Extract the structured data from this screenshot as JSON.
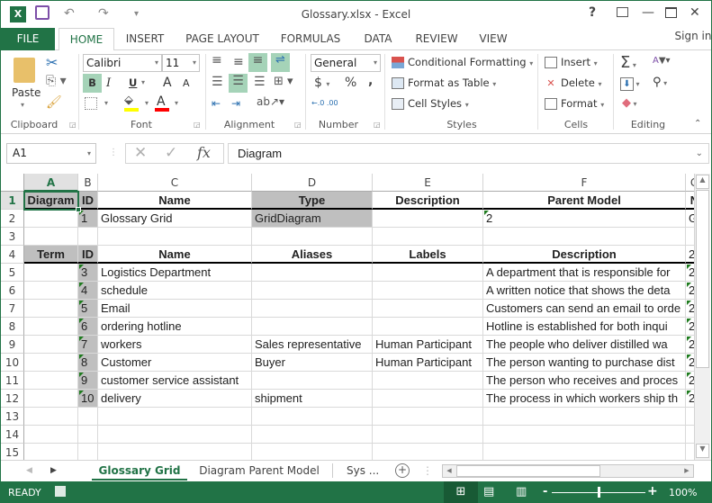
{
  "window": {
    "title": "Glossary.xlsx - Excel",
    "help": "?",
    "restore_ribbon": "⊼",
    "minimize": "—",
    "maximize": "☐",
    "close": "✕"
  },
  "quick_access": {
    "app_icon": "X",
    "save": "💾",
    "undo": "↶",
    "redo": "↷",
    "customize": "⩡"
  },
  "tabs": [
    "FILE",
    "HOME",
    "INSERT",
    "PAGE LAYOUT",
    "FORMULAS",
    "DATA",
    "REVIEW",
    "VIEW"
  ],
  "sign_in": "Sign in",
  "ribbon": {
    "clipboard": {
      "label": "Clipboard",
      "paste": "Paste"
    },
    "font": {
      "label": "Font",
      "name": "Calibri",
      "size": "11",
      "bold": "B",
      "italic": "I",
      "underline": "U",
      "grow": "A",
      "shrink": "A",
      "font_color": "A",
      "fill_color": "#ffff00",
      "text_color": "#ff0000"
    },
    "alignment": {
      "label": "Alignment"
    },
    "number": {
      "label": "Number",
      "format": "General",
      "currency": "$",
      "percent": "%",
      "comma": ",",
      "inc_dec": "←.0 .00",
      "dec_dec": ".00 →.0"
    },
    "styles": {
      "label": "Styles",
      "conditional": "Conditional Formatting",
      "format_table": "Format as Table",
      "cell_styles": "Cell Styles"
    },
    "cells": {
      "label": "Cells",
      "insert": "Insert",
      "delete": "Delete",
      "format": "Format"
    },
    "editing": {
      "label": "Editing",
      "sum": "Σ",
      "sort": "A↓Z",
      "find": "🔍",
      "fill": "⬇",
      "clear": "◆"
    }
  },
  "formula_bar": {
    "name_box": "A1",
    "cancel": "✕",
    "enter": "✓",
    "fx": "fx",
    "value": "Diagram"
  },
  "columns": [
    "A",
    "B",
    "C",
    "D",
    "E",
    "F",
    "G"
  ],
  "rows": [
    "1",
    "2",
    "3",
    "4",
    "5",
    "6",
    "7",
    "8",
    "9",
    "10",
    "11",
    "12",
    "13",
    "14",
    "15"
  ],
  "cells": {
    "r1": [
      "Diagram",
      "ID",
      "Name",
      "Type",
      "Description",
      "Parent Model",
      "N"
    ],
    "r2": [
      "",
      "1",
      "Glossary Grid",
      "GridDiagram",
      "",
      "2",
      "G"
    ],
    "r4": [
      "Term",
      "ID",
      "Name",
      "Aliases",
      "Labels",
      "Description",
      "2"
    ],
    "data": [
      [
        "",
        "3",
        "Logistics Department",
        "",
        "",
        "A department that is responsible for",
        "2"
      ],
      [
        "",
        "4",
        "schedule",
        "",
        "",
        "A written notice that shows the deta",
        "2"
      ],
      [
        "",
        "5",
        "Email",
        "",
        "",
        "Customers can send an email to orde",
        "2"
      ],
      [
        "",
        "6",
        "ordering hotline",
        "",
        "",
        "Hotline is established for both inqui",
        "2"
      ],
      [
        "",
        "7",
        "workers",
        "Sales representative",
        "Human Participant",
        "The people who deliver distilled wa",
        "2"
      ],
      [
        "",
        "8",
        "Customer",
        "Buyer",
        "Human Participant",
        "The person wanting to purchase dist",
        "2"
      ],
      [
        "",
        "9",
        "customer service assistant",
        "",
        "",
        "The person who receives and proces",
        "2"
      ],
      [
        "",
        "10",
        "delivery",
        "shipment",
        "",
        "The process in which workers ship th",
        "2"
      ]
    ]
  },
  "sheets": {
    "tabs": [
      "Glossary Grid",
      "Diagram Parent Model",
      "Sys ..."
    ],
    "active": "Glossary Grid",
    "add": "+"
  },
  "status": {
    "mode": "READY",
    "zoom": "100%",
    "zoom_fraction": 0.5
  }
}
